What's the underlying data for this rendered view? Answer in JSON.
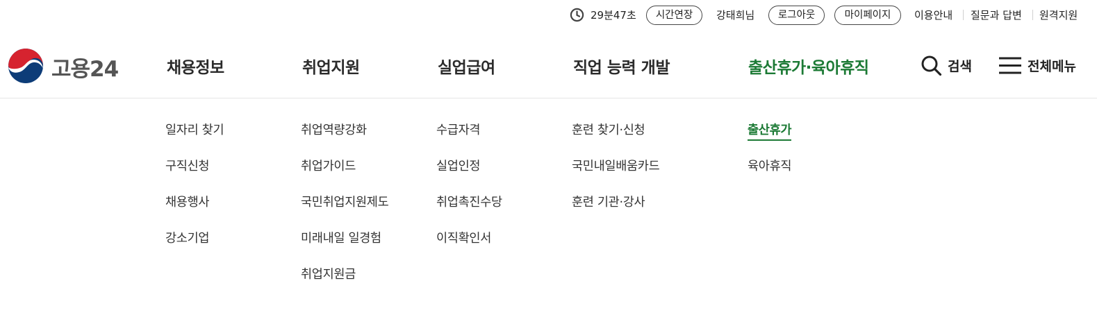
{
  "colors": {
    "accent": "#1c7a35",
    "text": "#222222",
    "divider": "#e6e6e6"
  },
  "util": {
    "timer": "29분47초",
    "extend_label": "시간연장",
    "user_name": "강태희님",
    "logout_label": "로그아웃",
    "mypage_label": "마이페이지",
    "links": [
      "이용안내",
      "질문과 답변",
      "원격지원"
    ]
  },
  "logo": {
    "text": "고용24",
    "icon": "taegeuk-logo-icon"
  },
  "gnb": [
    {
      "label": "채용정보",
      "active": false
    },
    {
      "label": "취업지원",
      "active": false
    },
    {
      "label": "실업급여",
      "active": false
    },
    {
      "label": "직업 능력 개발",
      "active": false
    },
    {
      "label": "출산휴가·육아휴직",
      "active": true
    }
  ],
  "search": {
    "label": "검색",
    "icon": "search-icon"
  },
  "all_menu": {
    "label": "전체메뉴",
    "icon": "hamburger-icon"
  },
  "submenu": [
    [
      "일자리 찾기",
      "구직신청",
      "채용행사",
      "강소기업"
    ],
    [
      "취업역량강화",
      "취업가이드",
      "국민취업지원제도",
      "미래내일 일경험",
      "취업지원금"
    ],
    [
      "수급자격",
      "실업인정",
      "취업촉진수당",
      "이직확인서"
    ],
    [
      "훈련 찾기·신청",
      "국민내일배움카드",
      "훈련 기관·강사"
    ],
    [
      "출산휴가",
      "육아휴직"
    ]
  ],
  "submenu_active": "출산휴가"
}
